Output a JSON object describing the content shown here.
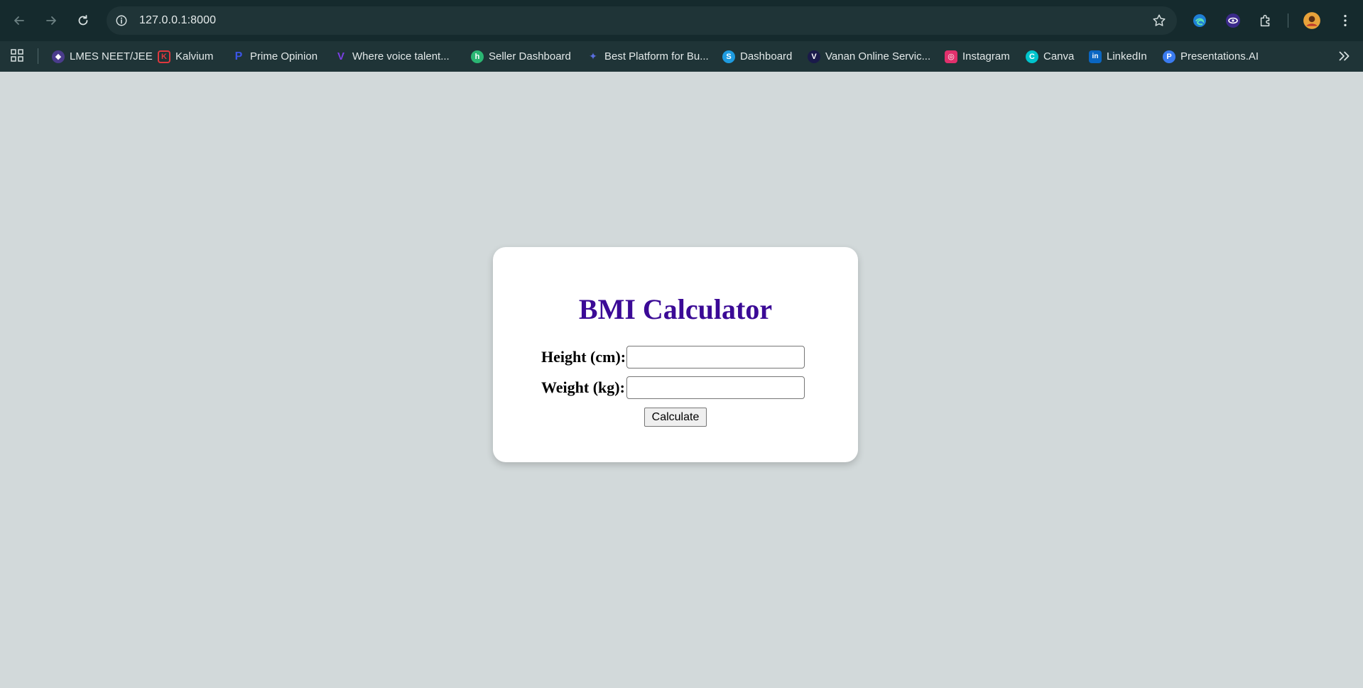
{
  "browser": {
    "url": "127.0.0.1:8000",
    "bookmarks": [
      {
        "label": "LMES NEET/JEE",
        "icon": "lmes-icon",
        "color": "#4a3c8c"
      },
      {
        "label": "Kalvium",
        "icon": "kalvium-icon",
        "color": "#e0383e"
      },
      {
        "label": "Prime Opinion",
        "icon": "prime-opinion-icon",
        "color": "#3b55e6"
      },
      {
        "label": "Where voice talent...",
        "icon": "voice-talent-icon",
        "color": "#7b3fe4"
      },
      {
        "label": "Seller Dashboard",
        "icon": "seller-dashboard-icon",
        "color": "#2bb673"
      },
      {
        "label": "Best Platform for Bu...",
        "icon": "best-platform-icon",
        "color": "#5a6ee0"
      },
      {
        "label": "Dashboard",
        "icon": "dashboard-icon",
        "color": "#1e9be0"
      },
      {
        "label": "Vanan Online Servic...",
        "icon": "vanan-icon",
        "color": "#1a1a4a"
      },
      {
        "label": "Instagram",
        "icon": "instagram-icon",
        "color": "#e1306c"
      },
      {
        "label": "Canva",
        "icon": "canva-icon",
        "color": "#00c4cc"
      },
      {
        "label": "LinkedIn",
        "icon": "linkedin-icon",
        "color": "#0a66c2"
      },
      {
        "label": "Presentations.AI",
        "icon": "presentations-ai-icon",
        "color": "#3a7bf0"
      }
    ]
  },
  "bmi": {
    "title": "BMI Calculator",
    "height_label": "Height (cm):",
    "weight_label": "Weight (kg):",
    "height_value": "",
    "weight_value": "",
    "button_label": "Calculate",
    "title_color": "#3b0a96"
  }
}
